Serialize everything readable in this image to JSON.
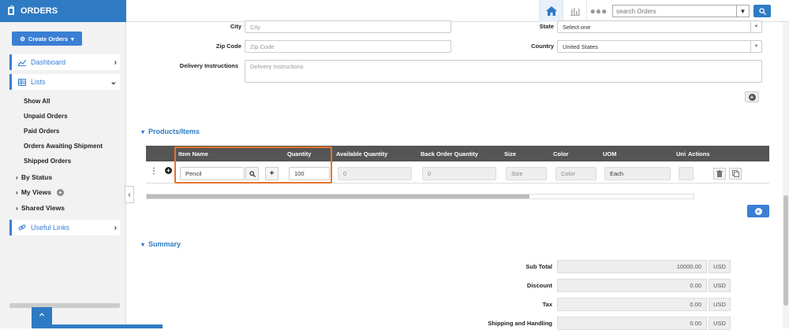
{
  "app": {
    "title": "ORDERS"
  },
  "topbar": {
    "search_placeholder": "search Orders"
  },
  "sidebar": {
    "create_label": "Create Orders",
    "dashboard": "Dashboard",
    "lists": "Lists",
    "list_items": [
      "Show All",
      "Unpaid Orders",
      "Paid Orders",
      "Orders Awaiting Shipment",
      "Shipped Orders"
    ],
    "by_status": "By Status",
    "my_views": "My Views",
    "shared_views": "Shared Views",
    "useful_links": "Useful Links"
  },
  "address": {
    "city_label": "City",
    "city_placeholder": "City",
    "zip_label": "Zip Code",
    "zip_placeholder": "Zip Code",
    "delivery_label": "Delivery Instructions",
    "delivery_placeholder": "Delivery Instructions",
    "state_label": "State",
    "state_value": "Select one",
    "country_label": "Country",
    "country_value": "United States"
  },
  "products": {
    "section_title": "Products/Items",
    "columns": [
      "Item Name",
      "Quantity",
      "Available Quantity",
      "Back Order Quantity",
      "Size",
      "Color",
      "UOM",
      "Uni",
      "Actions"
    ],
    "row": {
      "item_name": "Pencil",
      "quantity": "100",
      "available_quantity": "0",
      "back_order_quantity": "0",
      "size": "Size",
      "color": "Color",
      "uom": "Each"
    }
  },
  "summary": {
    "section_title": "Summary",
    "rows": [
      {
        "label": "Sub Total",
        "value": "10000.00",
        "unit": "USD"
      },
      {
        "label": "Discount",
        "value": "0.00",
        "unit": "USD"
      },
      {
        "label": "Tax",
        "value": "0.00",
        "unit": "USD"
      },
      {
        "label": "Shipping and Handling",
        "value": "0.00",
        "unit": "USD"
      }
    ]
  },
  "colors": {
    "accent": "#2f7bc3",
    "highlight": "#e8732b",
    "table_header": "#555555"
  }
}
